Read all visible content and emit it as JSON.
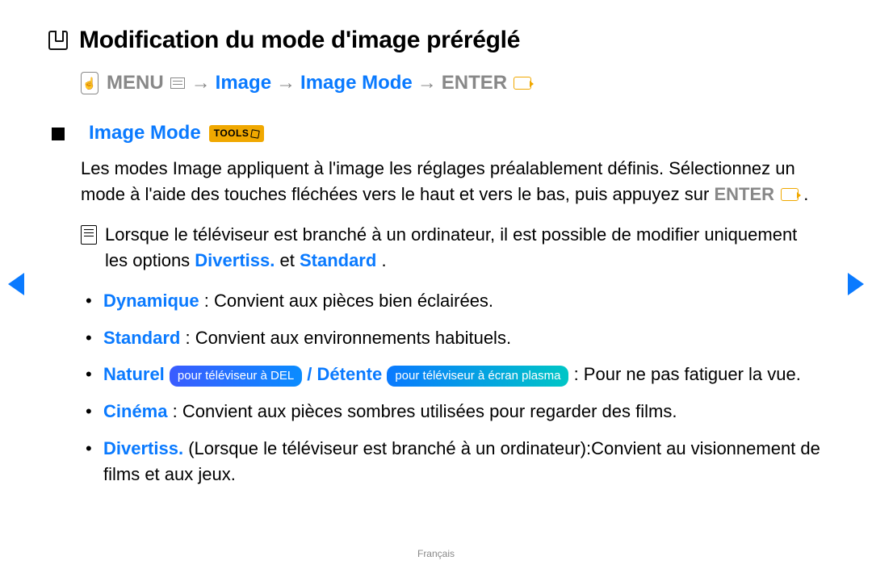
{
  "title": "Modification du mode d'image préréglé",
  "breadcrumb": {
    "menu": "MENU",
    "step1": "Image",
    "step2": "Image Mode",
    "enter": "ENTER",
    "arrow": "→"
  },
  "section": {
    "title": "Image Mode",
    "tools_label": "TOOLS"
  },
  "intro": {
    "line1": "Les modes Image appliquent à l'image les réglages préalablement définis. Sélectionnez un mode à l'aide des touches fléchées vers le haut et vers le bas, puis appuyez sur ",
    "enter": "ENTER",
    "period": "."
  },
  "note": {
    "pre": "Lorsque le téléviseur est branché à un ordinateur, il est possible de modifier uniquement les options ",
    "opt1": "Divertiss.",
    "mid": " et ",
    "opt2": "Standard",
    "post": "."
  },
  "modes": {
    "dynamique": {
      "name": "Dynamique",
      "desc": " : Convient aux pièces bien éclairées."
    },
    "standard": {
      "name": "Standard",
      "desc": " : Convient aux environnements habituels."
    },
    "naturel": {
      "name": "Naturel",
      "pill_del": "pour téléviseur à DEL",
      "slash": " / ",
      "detente": "Détente",
      "pill_plasma": "pour téléviseur à écran plasma",
      "desc": " : Pour ne pas fatiguer la vue."
    },
    "cinema": {
      "name": "Cinéma",
      "desc": ": Convient aux pièces sombres utilisées pour regarder des films."
    },
    "divertiss": {
      "name": "Divertiss.",
      "desc": " (Lorsque le téléviseur est branché à un ordinateur):Convient au visionnement de films et aux jeux."
    }
  },
  "footer": "Français"
}
